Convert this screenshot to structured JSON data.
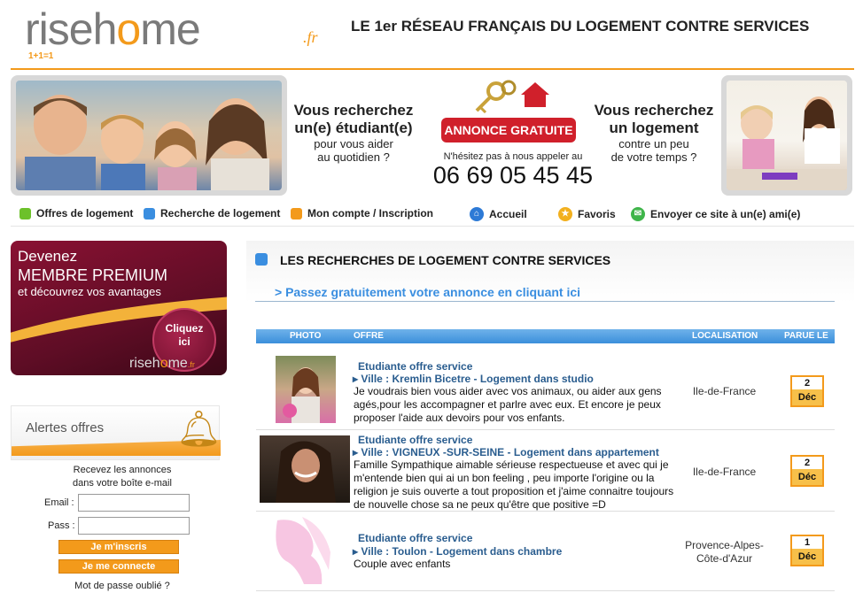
{
  "header": {
    "logo_text_pre": "riseh",
    "logo_text_o": "o",
    "logo_text_post": "me",
    "logo_tld": ".fr",
    "logo_tagline": "1+1=1",
    "tagline": "LE 1er RÉSEAU FRANÇAIS DU LOGEMENT CONTRE SERVICES"
  },
  "banner": {
    "left_big1": "Vous recherchez",
    "left_big2": "un(e) étudiant(e)",
    "left_small1": "pour vous aider",
    "left_small2": "au quotidien ?",
    "cta": "ANNONCE GRATUITE",
    "phone_note": "N'hésitez pas à nous appeler au",
    "phone": "06 69 05 45 45",
    "right_big1": "Vous recherchez",
    "right_big2": "un logement",
    "right_small1": "contre un peu",
    "right_small2": "de votre temps ?"
  },
  "nav": {
    "items": [
      {
        "label": "Offres de logement",
        "color": "#6cc12a"
      },
      {
        "label": "Recherche de logement",
        "color": "#3a8ee0"
      },
      {
        "label": "Mon compte / Inscription",
        "color": "#f39a1b"
      },
      {
        "label": "Accueil",
        "icon": "home-icon"
      },
      {
        "label": "Favoris",
        "icon": "star-icon"
      },
      {
        "label": "Envoyer ce site à un(e) ami(e)",
        "icon": "mail-icon"
      }
    ]
  },
  "premium": {
    "line1": "Devenez",
    "line2": "MEMBRE PREMIUM",
    "line3": "et découvrez vos avantages",
    "click1": "Cliquez",
    "click2": "ici",
    "mini_pre": "riseh",
    "mini_o": "o",
    "mini_post": "me",
    "mini_tld": ".fr"
  },
  "alerts": {
    "title": "Alertes offres",
    "intro1": "Recevez les annonces",
    "intro2": "dans votre boîte e-mail",
    "email_label": "Email :",
    "pass_label": "Pass :",
    "email_value": "",
    "pass_value": "",
    "signup_button": "Je m'inscris",
    "login_button": "Je me connecte",
    "forgot": "Mot de passe oublié ?"
  },
  "main": {
    "title": "LES RECHERCHES DE LOGEMENT CONTRE SERVICES",
    "post_link": "> Passez gratuitement votre annonce en cliquant ici",
    "columns": [
      "PHOTO",
      "OFFRE",
      "LOCALISATION",
      "PARUE LE"
    ],
    "listings": [
      {
        "category": "Etudiante offre service",
        "city": "Ville : Kremlin Bicetre - Logement dans studio",
        "description": "Je voudrais bien vous aider avec vos animaux, ou aider aux gens agés,pour les accompagner et parlre avec eux. Et encore je peux proposer l'aide aux devoirs pour vos enfants.",
        "location": "Ile-de-France",
        "day": "2",
        "month": "Déc"
      },
      {
        "category": "Etudiante offre service",
        "city": "Ville : VIGNEUX -SUR-SEINE - Logement dans appartement",
        "description": "Famille Sympathique aimable sérieuse respectueuse et avec qui je m'entende bien qui ai un bon feeling , peu importe l'origine ou la religion je suis ouverte a tout proposition et j'aime connaitre toujours de nouvelle chose sa ne peux qu'être que positive =D",
        "location": "Ile-de-France",
        "day": "2",
        "month": "Déc"
      },
      {
        "category": "Etudiante offre service",
        "city": "Ville : Toulon - Logement dans chambre",
        "description": "Couple avec enfants",
        "location_line1": "Provence-Alpes-",
        "location_line2": "Côte-d'Azur",
        "day": "1",
        "month": "Déc"
      }
    ]
  }
}
